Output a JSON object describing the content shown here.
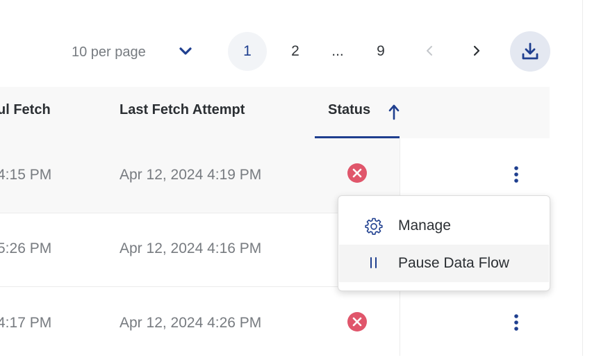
{
  "pagination": {
    "per_page_label": "10 per page",
    "pages": [
      "1",
      "2",
      "...",
      "9"
    ],
    "active_page": "1"
  },
  "table": {
    "columns": {
      "last_successful_fetch": "ul Fetch",
      "last_fetch_attempt": "Last Fetch Attempt",
      "status": "Status"
    },
    "rows": [
      {
        "last_successful_fetch": "4:15 PM",
        "last_fetch_attempt": "Apr 12, 2024 4:19 PM",
        "status": "error"
      },
      {
        "last_successful_fetch": "5:26 PM",
        "last_fetch_attempt": "Apr 12, 2024 4:16 PM",
        "status": ""
      },
      {
        "last_successful_fetch": "4:17 PM",
        "last_fetch_attempt": "Apr 12, 2024 4:26 PM",
        "status": "error"
      }
    ]
  },
  "menu": {
    "items": [
      {
        "label": "Manage",
        "icon": "gear-icon"
      },
      {
        "label": "Pause Data Flow",
        "icon": "pause-icon"
      }
    ]
  },
  "colors": {
    "accent": "#1f3f8f",
    "error": "#e0566b",
    "header_bg": "#f8f8f8",
    "muted_text": "#777b80"
  }
}
